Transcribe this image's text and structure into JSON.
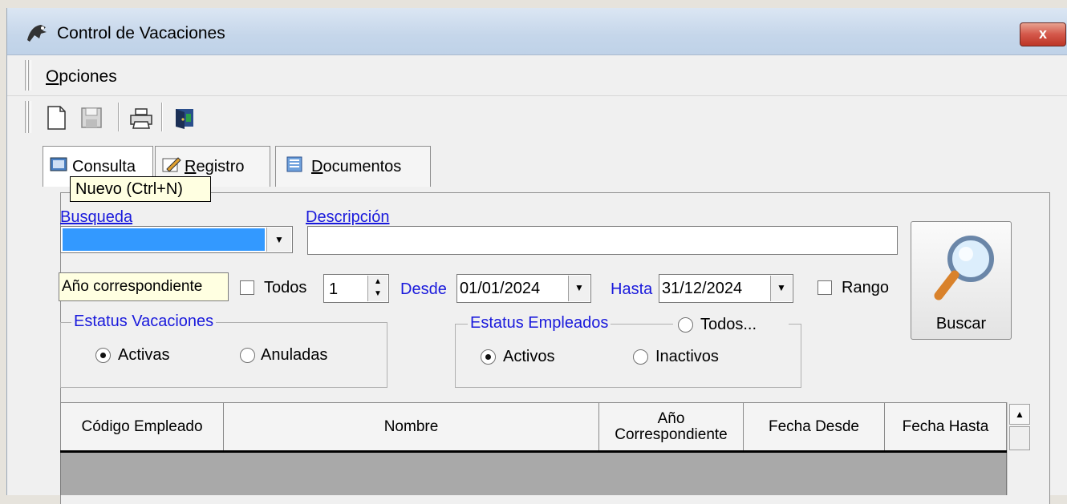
{
  "window": {
    "title": "Control de Vacaciones",
    "close_label": "x",
    "app_icon": "app-icon"
  },
  "menu": {
    "opciones": "Opciones"
  },
  "toolbar": {
    "icons": [
      "new-document-icon",
      "save-icon",
      "print-icon",
      "exit-icon"
    ]
  },
  "tooltip": "Nuevo (Ctrl+N)",
  "tabs": [
    {
      "label": "Consulta",
      "icon": "consulta-icon",
      "active": true
    },
    {
      "label": "Registro",
      "icon": "registro-icon",
      "active": false
    },
    {
      "label": "Documentos",
      "icon": "documentos-icon",
      "active": false
    }
  ],
  "form": {
    "busqueda_label": "Busqueda",
    "descripcion_label": "Descripción",
    "descripcion_value": "",
    "anio_label": "Año correspondiente",
    "todos_label": "Todos",
    "anio_value": "1",
    "desde_label": "Desde",
    "desde_value": "01/01/2024",
    "hasta_label": "Hasta",
    "hasta_value": "31/12/2024",
    "rango_label": "Rango",
    "buscar_label": "Buscar"
  },
  "estatus_vacaciones": {
    "legend": "Estatus Vacaciones",
    "opt1": "Activas",
    "opt2": "Anuladas",
    "selected": "Activas"
  },
  "estatus_empleados": {
    "legend": "Estatus Empleados",
    "todos": "Todos...",
    "opt1": "Activos",
    "opt2": "Inactivos",
    "selected": "Activos"
  },
  "grid": {
    "columns": [
      "Código Empleado",
      "Nombre",
      "Año Correspondiente",
      "Fecha Desde",
      "Fecha Hasta"
    ],
    "rows": []
  },
  "colors": {
    "accent_blue": "#1a1adc",
    "selection": "#3399ff",
    "grid_body": "#a9a9a9"
  }
}
